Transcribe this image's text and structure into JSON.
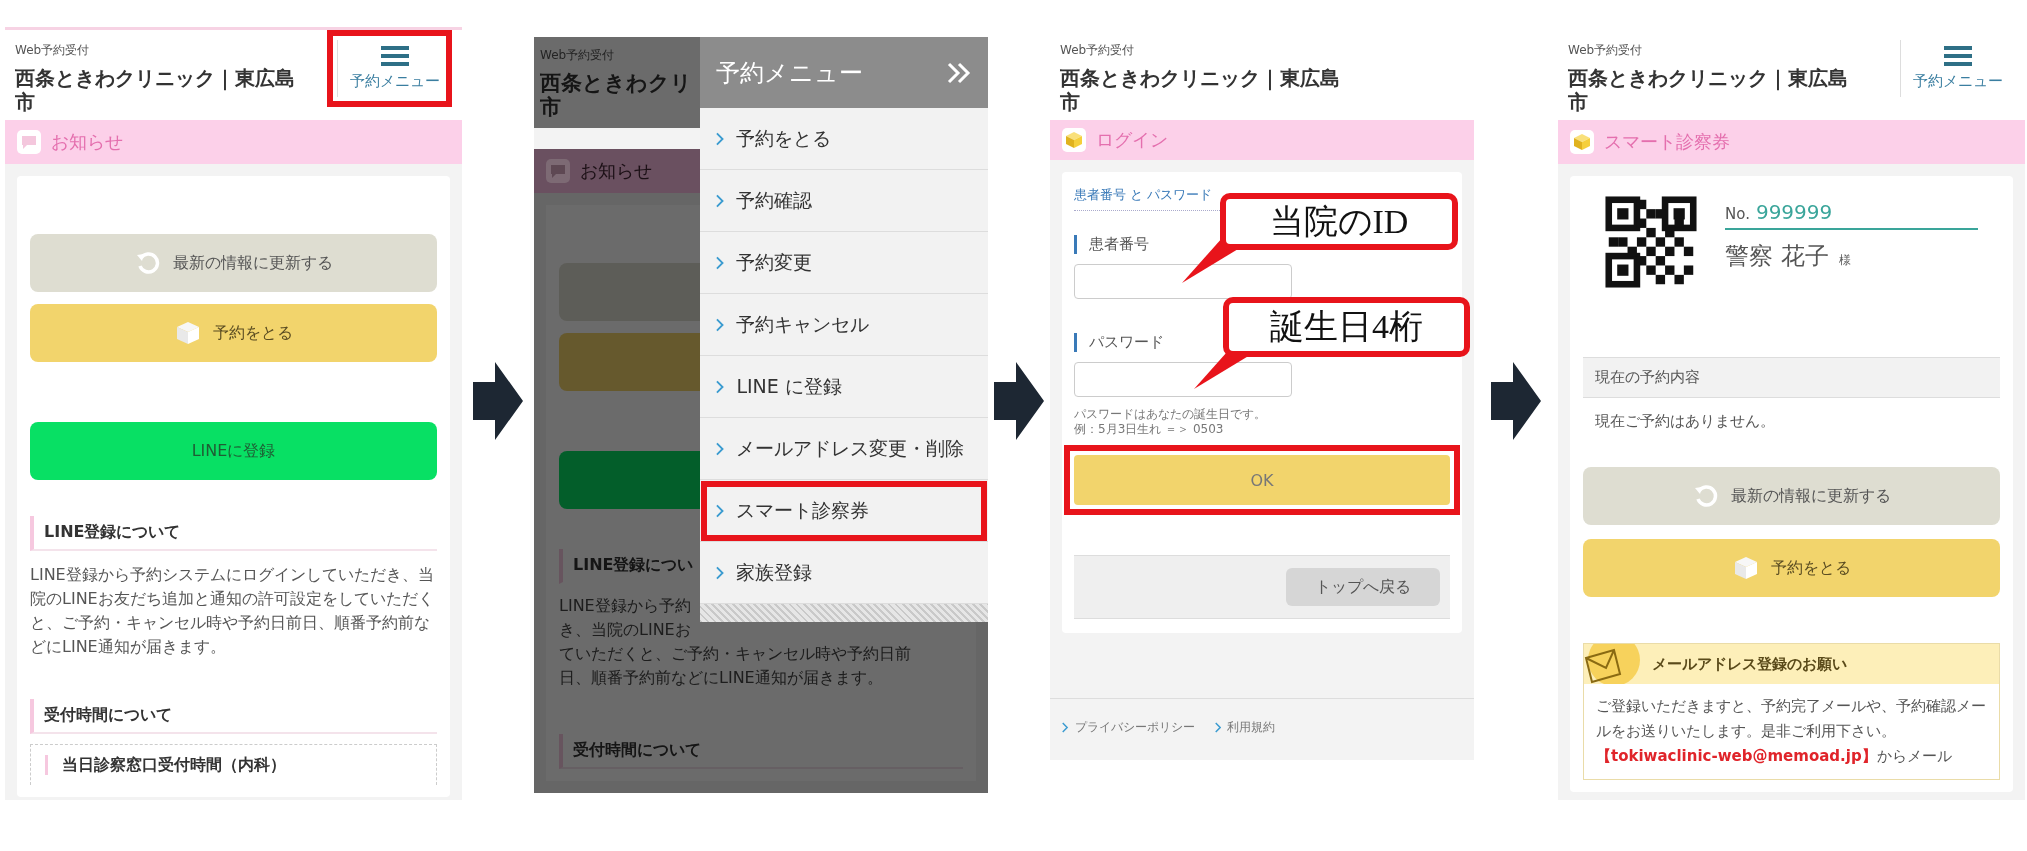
{
  "screens": [
    {
      "kind": "home",
      "site_label": "Web予約受付",
      "title": "西条ときわクリニック｜東広島市",
      "menu_button": {
        "label": "予約メニュー",
        "annotated": true
      },
      "section": {
        "title": "お知らせ"
      },
      "buttons": [
        {
          "kind": "refresh",
          "label": "最新の情報に更新する"
        },
        {
          "kind": "reserve",
          "label": "予約をとる"
        },
        {
          "kind": "line",
          "label": "LINEに登録"
        }
      ],
      "blocks": [
        {
          "heading": "LINE登録について",
          "text": "LINE登録から予約システムにログインしていただき、当院のLINEお友だち追加と通知の許可設定をしていただくと、ご予約・キャンセル時や予約日前日、順番予約前などにLINE通知が届きます。"
        },
        {
          "heading": "受付時間について",
          "subheading": "当日診察窓口受付時間（内科）"
        }
      ]
    },
    {
      "kind": "menu_open",
      "background": {
        "site_label": "Web予約受付",
        "title": "西条ときわクリ",
        "title_line_2": "市",
        "section_title": "お知らせ",
        "heading": "LINE登録につい",
        "lines": [
          "LINE登録から予約",
          "き、当院のLINEお",
          "ていただくと、ご予約・キャンセル時や予約日前",
          "日、順番予約前などにLINE通知が届きます。"
        ],
        "heading_2": "受付時間について"
      },
      "menu": {
        "title": "予約メニュー",
        "items": [
          {
            "label": "予約をとる",
            "annotated": false
          },
          {
            "label": "予約確認",
            "annotated": false
          },
          {
            "label": "予約変更",
            "annotated": false
          },
          {
            "label": "予約キャンセル",
            "annotated": false
          },
          {
            "label": "LINE に登録",
            "annotated": false
          },
          {
            "label": "メールアドレス変更・削除",
            "annotated": false
          },
          {
            "label": "スマート診察券",
            "annotated": true
          },
          {
            "label": "家族登録",
            "annotated": false
          }
        ]
      }
    },
    {
      "kind": "login",
      "site_label": "Web予約受付",
      "title": "西条ときわクリニック｜東広島市",
      "section": {
        "title": "ログイン"
      },
      "instruction": "患者番号 と パスワード",
      "fields": [
        {
          "label": "患者番号",
          "callout": "当院のID"
        },
        {
          "label": "パスワード",
          "callout": "誕生日4桁"
        }
      ],
      "hint_lines": [
        "パスワードはあなたの誕生日です。",
        "例：5月3日生れ ＝＞ 0503"
      ],
      "ok_button": {
        "label": "OK",
        "annotated": true
      },
      "back_button": "トップへ戻る",
      "footer_links": [
        "プライバシーポリシー",
        "利用規約"
      ]
    },
    {
      "kind": "card",
      "site_label": "Web予約受付",
      "title": "西条ときわクリニック｜東広島市",
      "menu_button": {
        "label": "予約メニュー",
        "annotated": false
      },
      "section": {
        "title": "スマート診察券"
      },
      "patient": {
        "number_label": "No.",
        "number": "999999",
        "name": "警察 花子",
        "honorific": "様"
      },
      "reservation": {
        "heading": "現在の予約内容",
        "text": "現在ご予約はありません。"
      },
      "buttons": [
        {
          "kind": "refresh",
          "label": "最新の情報に更新する"
        },
        {
          "kind": "reserve",
          "label": "予約をとる"
        }
      ],
      "notice": {
        "title": "メールアドレス登録のお願い",
        "text": "ご登録いただきますと、予約完了メールや、予約確認メールをお送りいたします。是非ご利用下さい。**【tokiwaclinic-web@memoad.jp】**からメール"
      }
    }
  ]
}
